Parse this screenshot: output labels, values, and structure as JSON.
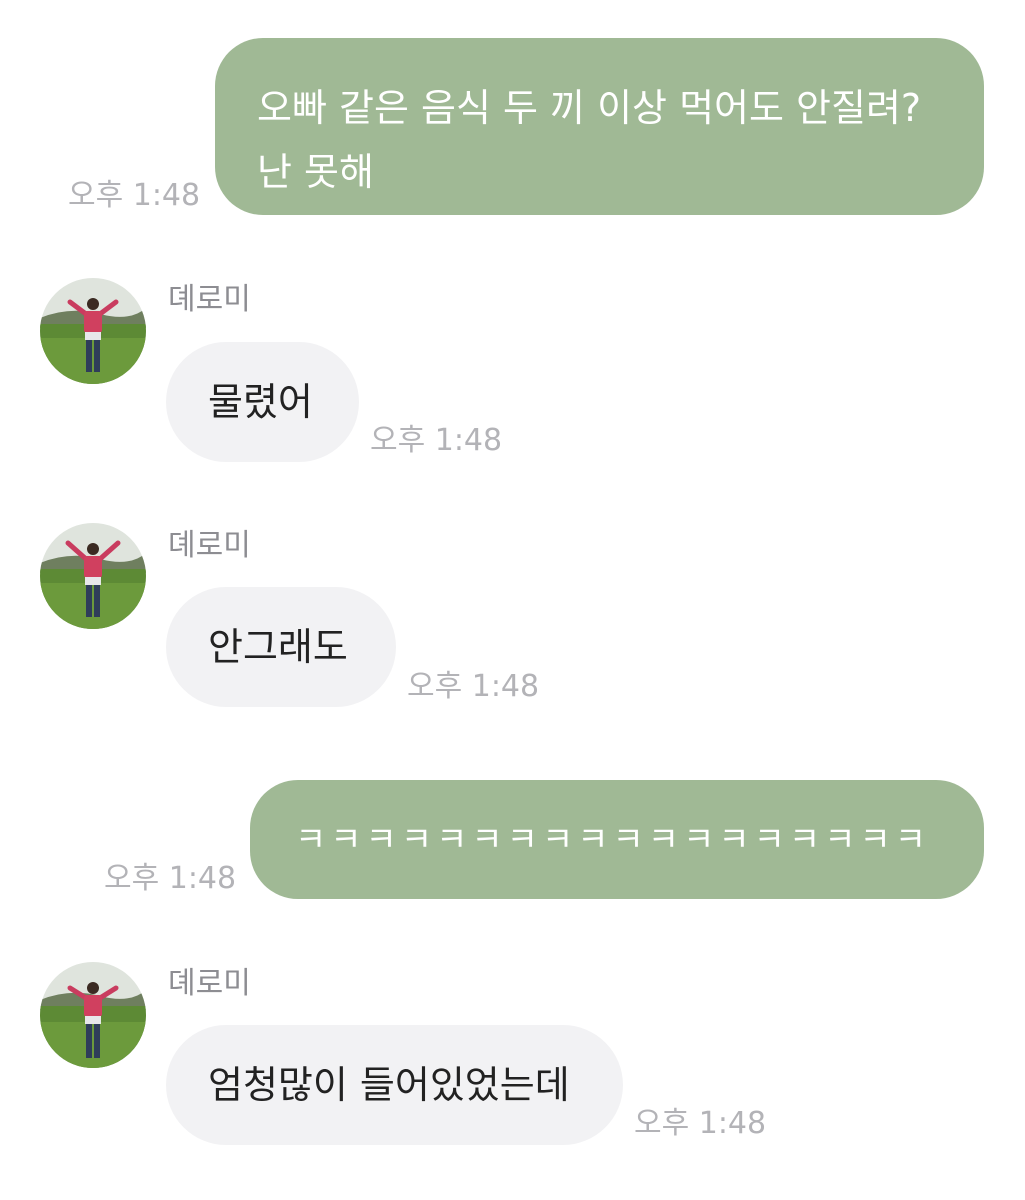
{
  "messages": [
    {
      "side": "me",
      "text_line1": "오빠 같은 음식 두 끼 이상 먹어도 안질려?",
      "text_line2": "난 못해",
      "time": "오후 1:48"
    },
    {
      "side": "them",
      "sender": "뎨로미",
      "text": "물렸어",
      "time": "오후 1:48",
      "avatar": "profile-photo"
    },
    {
      "side": "them",
      "sender": "뎨로미",
      "text": "안그래도",
      "time": "오후 1:48",
      "avatar": "profile-photo"
    },
    {
      "side": "me",
      "text": "ㅋㅋㅋㅋㅋㅋㅋㅋㅋㅋㅋㅋㅋㅋㅋㅋㅋㅋ",
      "time": "오후 1:48"
    },
    {
      "side": "them",
      "sender": "뎨로미",
      "text": "엄청많이 들어있었는데",
      "time": "오후 1:48",
      "avatar": "profile-photo"
    }
  ],
  "colors": {
    "my_bubble": "#a0b995",
    "their_bubble": "#f2f2f4",
    "time_text": "#b3b3b7",
    "sender_text": "#8d8d92"
  }
}
